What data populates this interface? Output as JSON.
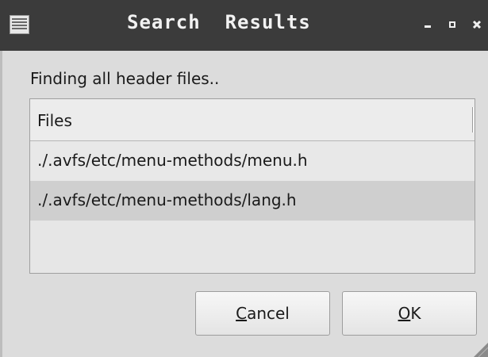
{
  "window": {
    "title": "Search  Results"
  },
  "titlebar_icons": {
    "menu": "window-menu-icon",
    "minimize": "minimize-icon",
    "maximize": "maximize-icon",
    "close": "close-icon"
  },
  "dialog": {
    "message": "Finding all header files..",
    "list": {
      "column_header": "Files",
      "rows": [
        "./.avfs/etc/menu-methods/menu.h",
        "./.avfs/etc/menu-methods/lang.h"
      ]
    },
    "buttons": {
      "cancel": {
        "mnemonic": "C",
        "rest": "ancel"
      },
      "ok": {
        "mnemonic": "O",
        "rest": "K"
      }
    }
  },
  "colors": {
    "titlebar": "#3b3b3b",
    "dialog_bg": "#dcdcdc",
    "selected_row": "#cfcfcf"
  }
}
